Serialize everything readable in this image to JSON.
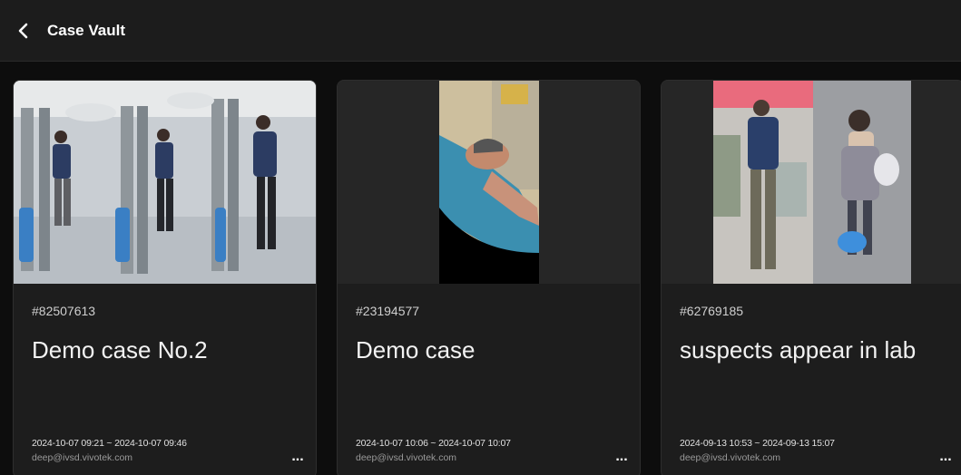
{
  "header": {
    "title": "Case Vault",
    "back_icon": "chevron-left-icon"
  },
  "cases": [
    {
      "id": "#82507613",
      "title": "Demo case No.2",
      "range": "2024-10-07 09:21 ~ 2024-10-07 09:46",
      "owner": "deep@ivsd.vivotek.com",
      "more": "..."
    },
    {
      "id": "#23194577",
      "title": "Demo case",
      "range": "2024-10-07 10:06 ~ 2024-10-07 10:07",
      "owner": "deep@ivsd.vivotek.com",
      "more": "..."
    },
    {
      "id": "#62769185",
      "title": "suspects appear in lab",
      "range": "2024-09-13 10:53 ~ 2024-09-13 15:07",
      "owner": "deep@ivsd.vivotek.com",
      "more": "..."
    }
  ],
  "colors": {
    "background": "#0d0d0d",
    "header": "#1c1c1c",
    "card": "#1d1d1d"
  }
}
